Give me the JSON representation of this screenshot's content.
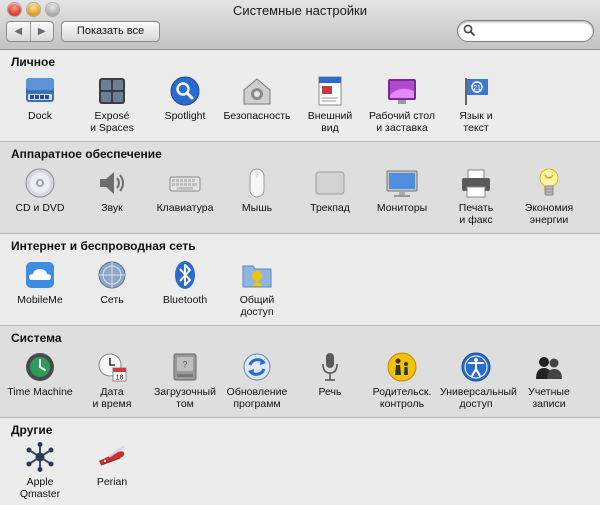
{
  "window": {
    "title": "Системные настройки"
  },
  "toolbar": {
    "back": "◀",
    "forward": "▶",
    "show_all": "Показать все",
    "search_value": ""
  },
  "sections": {
    "personal": {
      "title": "Личное",
      "items": [
        "Dock",
        "Exposé\nи Spaces",
        "Spotlight",
        "Безопасность",
        "Внешний\nвид",
        "Рабочий стол\nи заставка",
        "Язык и\nтекст"
      ]
    },
    "hardware": {
      "title": "Аппаратное обеспечение",
      "items": [
        "CD и DVD",
        "Звук",
        "Клавиатура",
        "Мышь",
        "Трекпад",
        "Мониторы",
        "Печать\nи факс",
        "Экономия\nэнергии"
      ]
    },
    "internet": {
      "title": "Интернет и беспроводная сеть",
      "items": [
        "MobileMe",
        "Сеть",
        "Bluetooth",
        "Общий\nдоступ"
      ]
    },
    "system": {
      "title": "Система",
      "items": [
        "Time Machine",
        "Дата\nи время",
        "Загрузочный\nтом",
        "Обновление\nпрограмм",
        "Речь",
        "Родительск.\nконтроль",
        "Универсальный\nдоступ",
        "Учетные\nзаписи"
      ]
    },
    "other": {
      "title": "Другие",
      "items": [
        "Apple\nQmaster",
        "Perian"
      ]
    }
  },
  "icons": {
    "personal": [
      "dock-icon",
      "expose-icon",
      "spotlight-icon",
      "security-icon",
      "appearance-icon",
      "desktop-icon",
      "language-icon"
    ],
    "hardware": [
      "cd-dvd-icon",
      "sound-icon",
      "keyboard-icon",
      "mouse-icon",
      "trackpad-icon",
      "displays-icon",
      "print-fax-icon",
      "energy-saver-icon"
    ],
    "internet": [
      "mobileme-icon",
      "network-icon",
      "bluetooth-icon",
      "sharing-icon"
    ],
    "system": [
      "time-machine-icon",
      "date-time-icon",
      "startup-disk-icon",
      "software-update-icon",
      "speech-icon",
      "parental-controls-icon",
      "universal-access-icon",
      "accounts-icon"
    ],
    "other": [
      "qmaster-icon",
      "perian-icon"
    ]
  },
  "colors": {
    "accent_blue": "#2a6bd0",
    "yellow": "#f3c200",
    "section_bg": "#ececec",
    "section_alt_bg": "#dedede"
  }
}
